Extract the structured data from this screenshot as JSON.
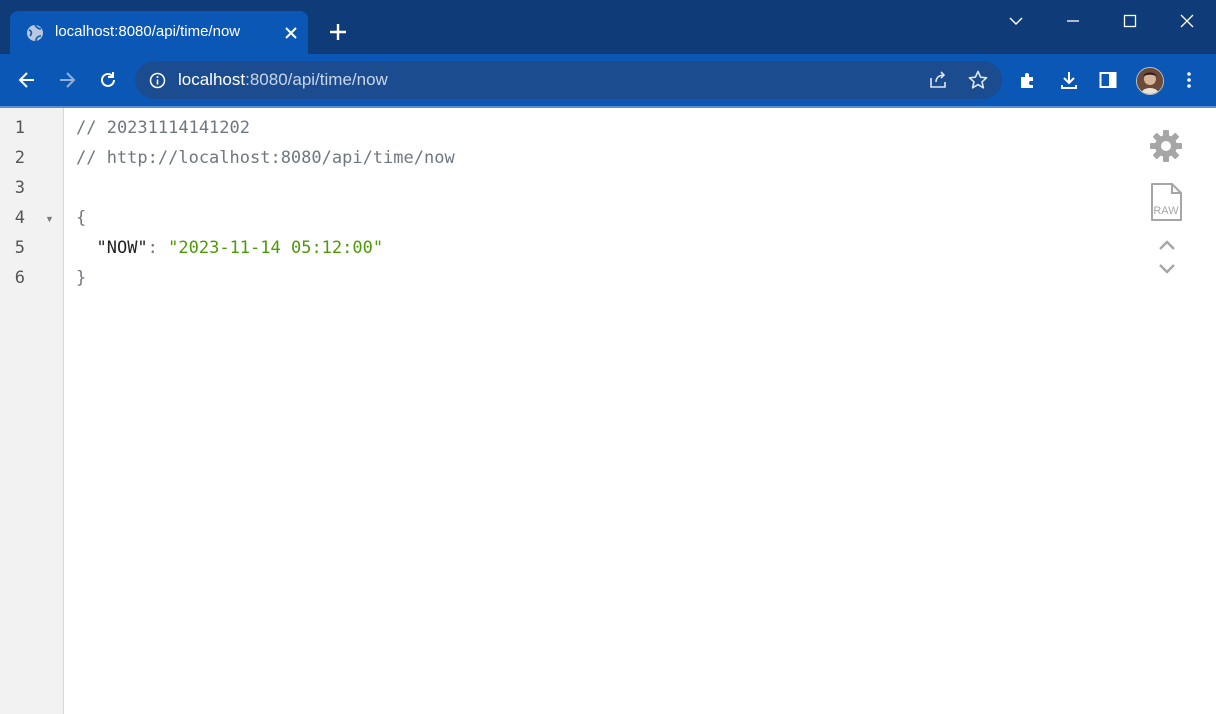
{
  "window": {
    "tab": {
      "title": "localhost:8080/api/time/now"
    }
  },
  "toolbar": {
    "url_host": "localhost",
    "url_path": ":8080/api/time/now"
  },
  "viewer": {
    "lines": [
      {
        "num": "1",
        "text": "// 20231114141202"
      },
      {
        "num": "2",
        "text": "// http://localhost:8080/api/time/now"
      },
      {
        "num": "3",
        "text": ""
      },
      {
        "num": "4",
        "text": "{"
      },
      {
        "num": "5",
        "key": "\"NOW\"",
        "colon": ": ",
        "value": "\"2023-11-14 05:12:00\""
      },
      {
        "num": "6",
        "text": "}"
      }
    ],
    "raw_label": "RAW"
  },
  "colors": {
    "titlebar": "#0f3c78",
    "toolbar": "#0b57b5",
    "string_value": "#4e9a06",
    "comment": "#6f7781"
  }
}
